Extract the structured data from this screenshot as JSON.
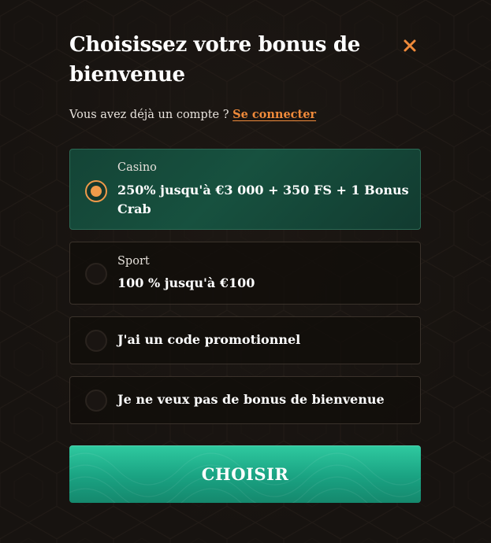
{
  "modal": {
    "title": "Choisissez votre bonus de bienvenue",
    "close_icon": "close-icon",
    "accent_color": "#ef8a3a",
    "selected_color": "#17513f",
    "button_color": "#1ea985"
  },
  "login": {
    "prompt": "Vous avez déjà un compte ?",
    "link_label": "Se connecter"
  },
  "options": [
    {
      "category": "Casino",
      "text": "250% jusqu'à €3 000 + 350 FS + 1 Bonus Crab",
      "selected": true
    },
    {
      "category": "Sport",
      "text": "100 % jusqu'à €100",
      "selected": false
    },
    {
      "category": "",
      "text": "J'ai un code promotionnel",
      "selected": false
    },
    {
      "category": "",
      "text": "Je ne veux pas de bonus de bienvenue",
      "selected": false
    }
  ],
  "cta": {
    "label": "CHOISIR"
  }
}
